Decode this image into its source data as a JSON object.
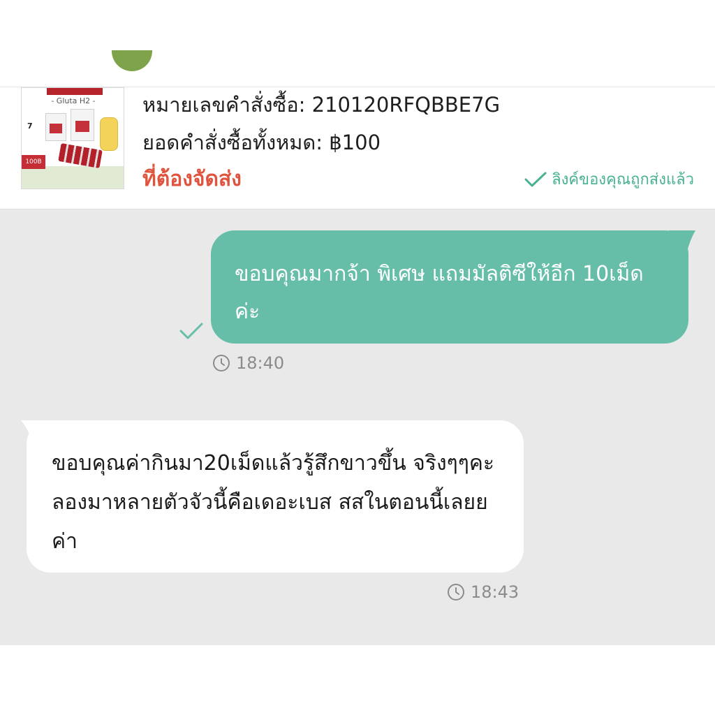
{
  "order": {
    "number_text": "หมายเลขคำสั่งซื้อ: 210120RFQBBE7G",
    "total_text": "ยอดคำสั่งซื้อทั้งหมด: ฿100",
    "status": "ที่ต้องจัดส่ง",
    "link_sent": "ลิงค์ของคุณถูกส่งแล้ว",
    "thumbnail": {
      "title": "- Gluta H2 -",
      "count": "7",
      "price": "100B"
    }
  },
  "messages": [
    {
      "direction": "outgoing",
      "text": "ขอบคุณมากจ้า พิเศษ แถมมัลติซีให้อีก 10เม็ดค่ะ",
      "time": "18:40",
      "read": true
    },
    {
      "direction": "incoming",
      "text": "ขอบคุณค่ากินมา20เม็ดแล้วรู้สึกขาวขึ้น จริงๆๆคะลองมาหลายตัวจัวนี้คือเดอะเบส สสในตอนนี้เลยยค่า",
      "time": "18:43"
    }
  ],
  "colors": {
    "outgoing_bubble": "#66bea8",
    "incoming_bubble": "#ffffff",
    "chat_background": "#e9e9e9",
    "status_orange": "#e0543d",
    "accent_green": "#47b191"
  },
  "icons": {
    "link_check": "check-icon",
    "read_receipt": "check-icon",
    "timestamp": "clock-icon"
  }
}
